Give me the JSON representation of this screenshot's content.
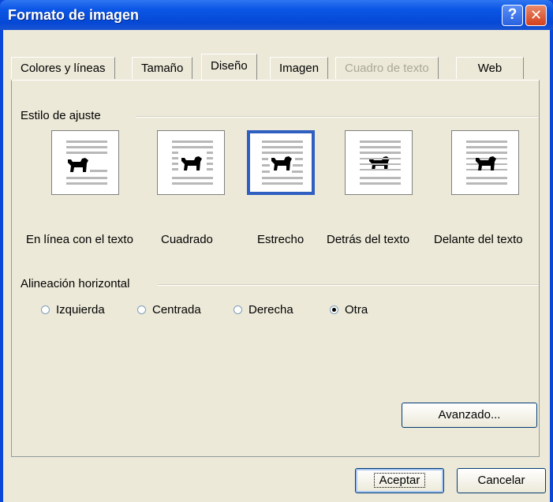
{
  "window": {
    "title": "Formato de imagen",
    "help_label": "?",
    "close_label": "✕"
  },
  "tabs": [
    {
      "label": "Colores y líneas",
      "state": "normal"
    },
    {
      "label": "Tamaño",
      "state": "normal"
    },
    {
      "label": "Diseño",
      "state": "active"
    },
    {
      "label": "Imagen",
      "state": "normal"
    },
    {
      "label": "Cuadro de texto",
      "state": "disabled"
    },
    {
      "label": "Web",
      "state": "normal"
    }
  ],
  "wrap_style": {
    "group_label": "Estilo de ajuste",
    "options": [
      {
        "label": "En línea con el texto",
        "icon": "inline-wrap-icon",
        "selected": false
      },
      {
        "label": "Cuadrado",
        "icon": "square-wrap-icon",
        "selected": false
      },
      {
        "label": "Estrecho",
        "icon": "tight-wrap-icon",
        "selected": true
      },
      {
        "label": "Detrás del texto",
        "icon": "behind-text-icon",
        "selected": false
      },
      {
        "label": "Delante del texto",
        "icon": "in-front-of-text-icon",
        "selected": false
      }
    ]
  },
  "horizontal_alignment": {
    "group_label": "Alineación horizontal",
    "options": [
      {
        "label": "Izquierda",
        "checked": false
      },
      {
        "label": "Centrada",
        "checked": false
      },
      {
        "label": "Derecha",
        "checked": false
      },
      {
        "label": "Otra",
        "checked": true
      }
    ]
  },
  "buttons": {
    "advanced": "Avanzado...",
    "ok": "Aceptar",
    "cancel": "Cancelar"
  },
  "colors": {
    "titlebar": "#0548d6",
    "dialog_bg": "#ece9d8",
    "selected_border": "#2f5fc0"
  }
}
